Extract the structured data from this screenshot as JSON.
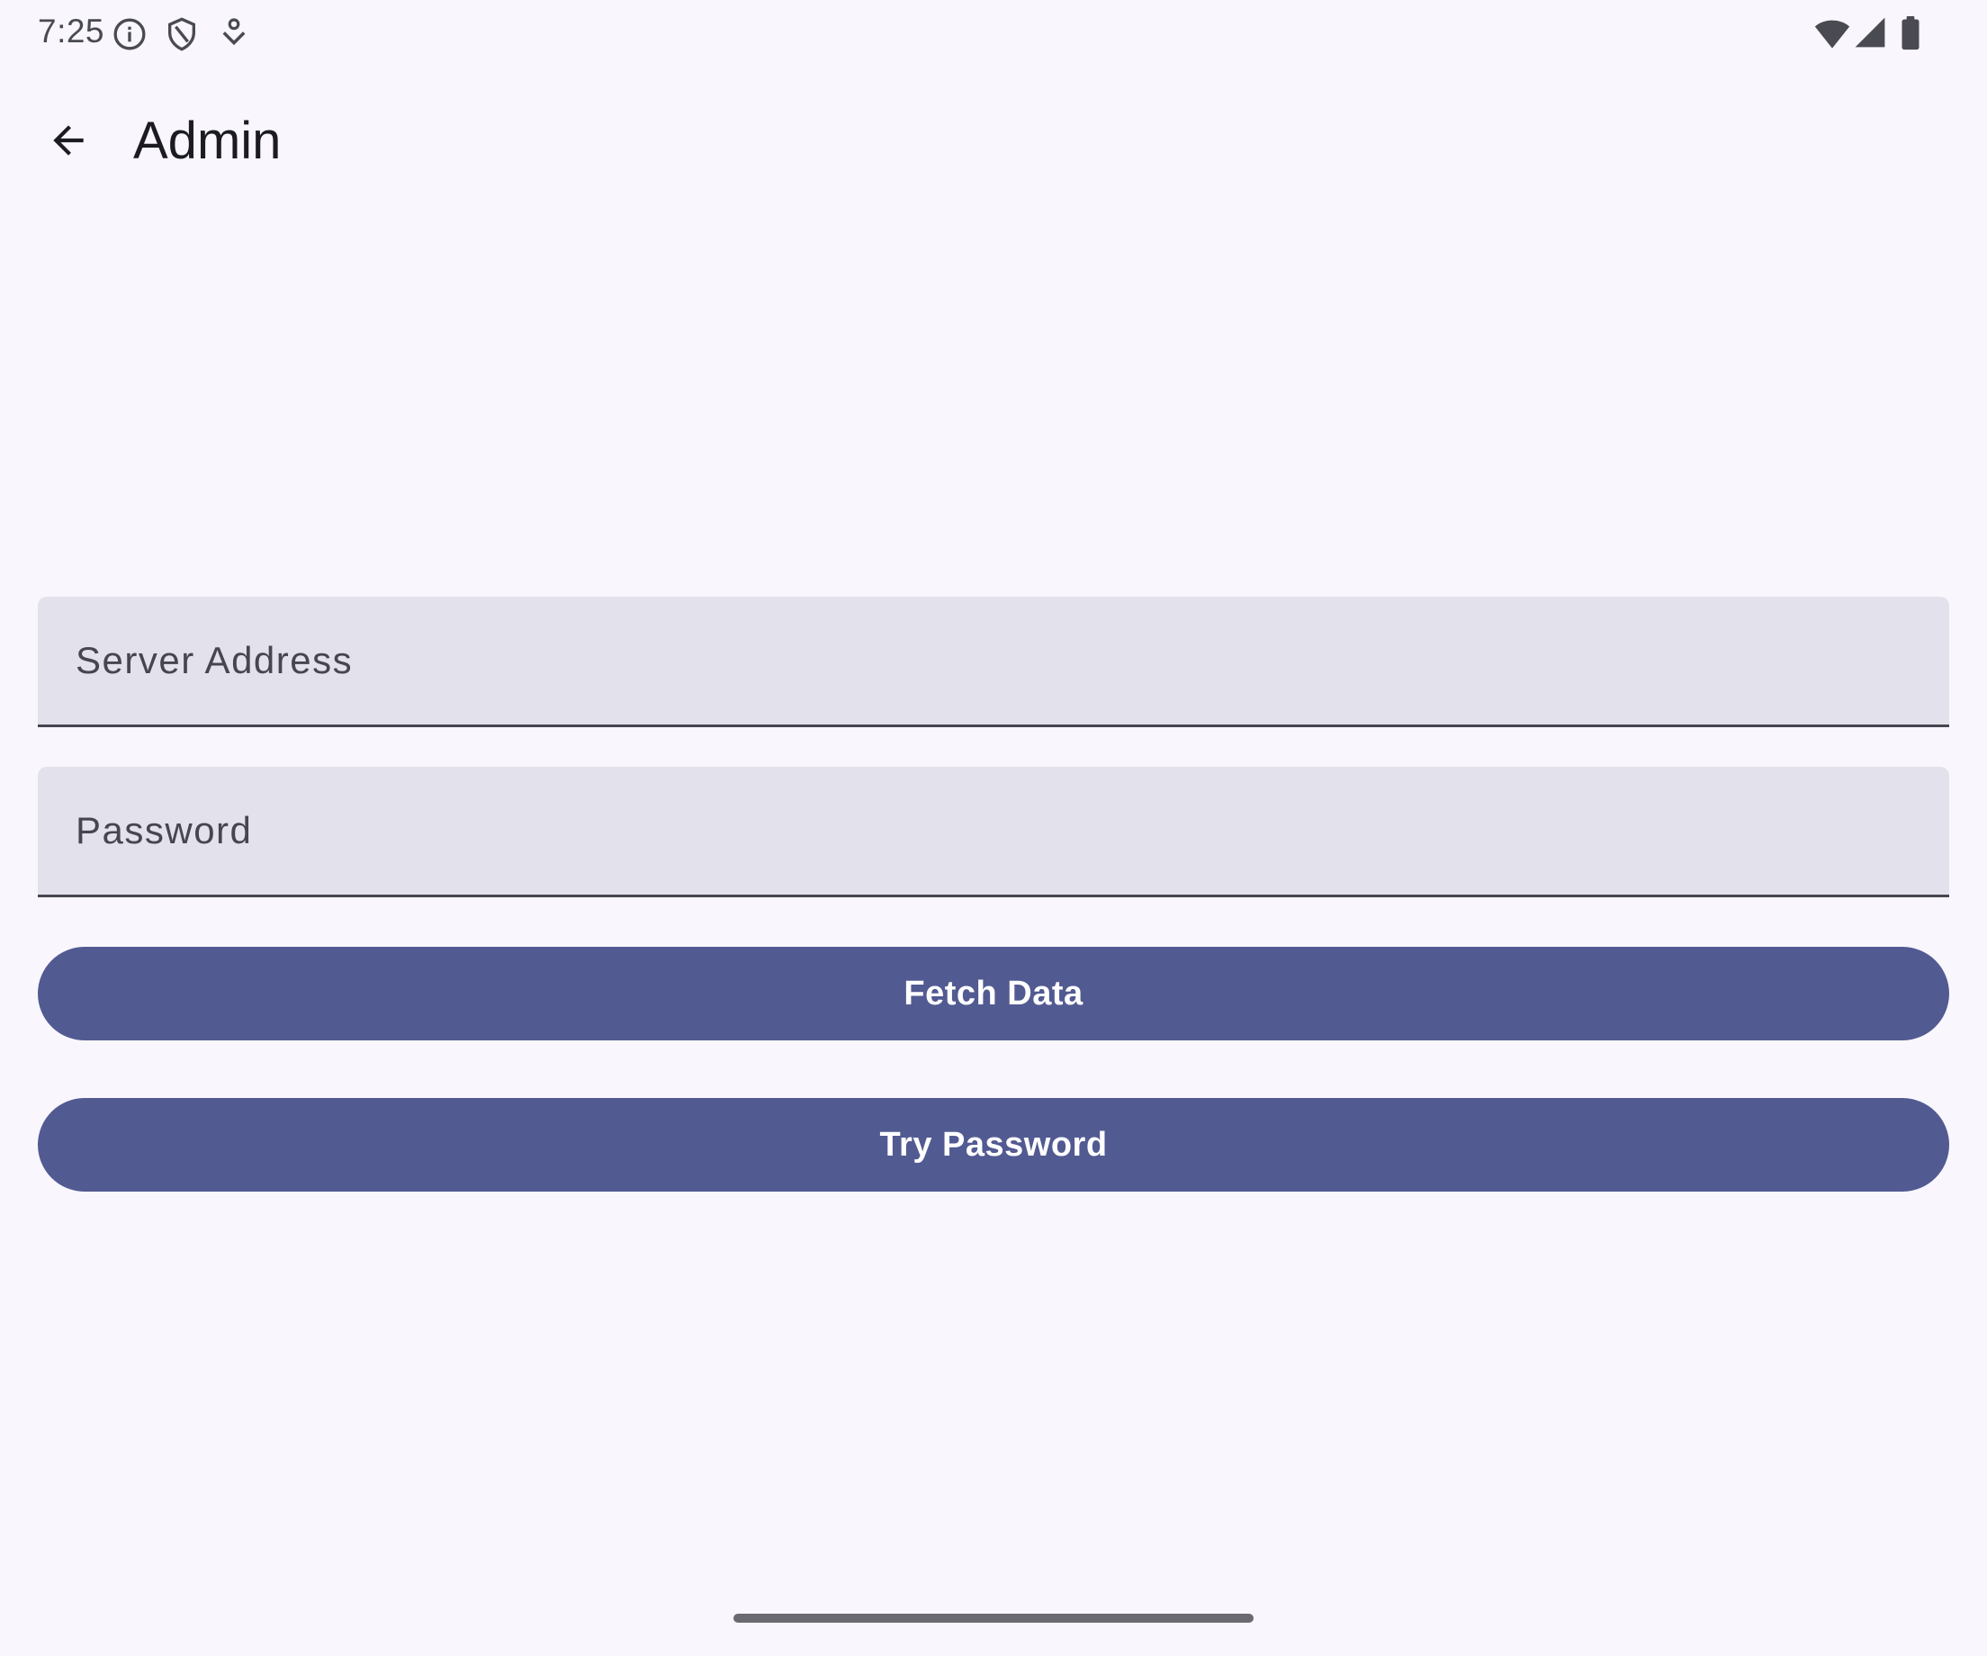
{
  "status_bar": {
    "time": "7:25",
    "left_icons": [
      "info-icon",
      "shield-icon",
      "download-icon"
    ],
    "right_icons": [
      "wifi-icon",
      "cell-signal-icon",
      "battery-icon"
    ]
  },
  "app_bar": {
    "back_icon": "arrow-back-icon",
    "title": "Admin"
  },
  "form": {
    "server_address": {
      "value": "",
      "placeholder": "Server Address"
    },
    "password": {
      "value": "",
      "placeholder": "Password"
    },
    "fetch_button_label": "Fetch Data",
    "try_password_button_label": "Try Password"
  },
  "colors": {
    "background": "#f9f6fd",
    "field_fill": "#e3e1ec",
    "primary": "#525a92",
    "on_primary": "#ffffff",
    "text": "#1b1b21"
  }
}
